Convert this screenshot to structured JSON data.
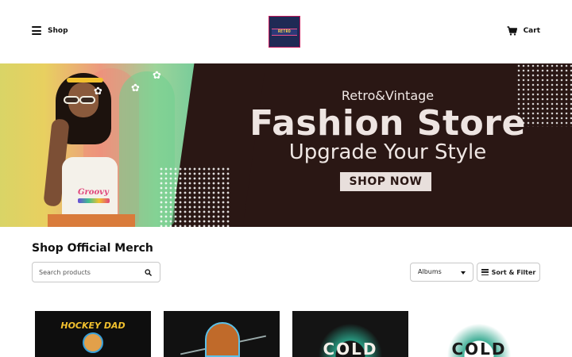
{
  "header": {
    "shop_label": "Shop",
    "cart_label": "Cart",
    "logo_text": "RETRO"
  },
  "banner": {
    "subtitle_top": "Retro&Vintage",
    "title": "Fashion Store",
    "tagline": "Upgrade Your Style",
    "cta_label": "SHOP NOW",
    "shirt_text": "Groovy"
  },
  "section": {
    "title": "Shop Official Merch"
  },
  "search": {
    "placeholder": "Search products",
    "value": ""
  },
  "filters": {
    "category_selected": "Albums",
    "sort_filter_label": "Sort & Filter"
  },
  "products": [
    {
      "art_text": "HOCKEY DAD"
    },
    {
      "art_text": ""
    },
    {
      "art_text": "COLD"
    },
    {
      "art_text": "COLD"
    }
  ],
  "colors": {
    "banner_bg": "#2a1714",
    "banner_text": "#efe7e4",
    "cta_bg": "#e8dfdc",
    "logo_bg": "#1f2a55",
    "logo_border": "#c2185b"
  },
  "icons": {
    "menu": "hamburger-icon",
    "cart": "cart-icon",
    "search": "search-icon",
    "sort": "sliders-icon",
    "dropdown": "chevron-down-icon"
  }
}
